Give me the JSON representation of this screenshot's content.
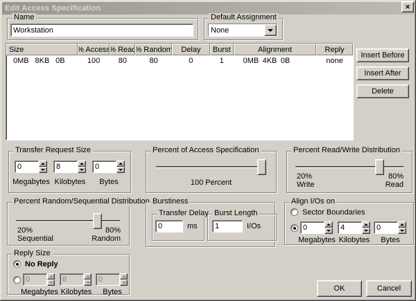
{
  "window": {
    "title": "Edit Access Specification",
    "close_glyph": "✕"
  },
  "name_group": {
    "label": "Name",
    "value": "Workstation"
  },
  "default_assignment_group": {
    "label": "Default Assignment",
    "value": "None"
  },
  "spec_table": {
    "columns": [
      "Size",
      "% Access",
      "% Read",
      "% Random",
      "Delay",
      "Burst",
      "Alignment",
      "Reply"
    ],
    "row": {
      "size": [
        "0MB",
        "8KB",
        "0B"
      ],
      "access": "100",
      "read": "80",
      "random": "80",
      "delay": "0",
      "burst": "1",
      "alignment": [
        "0MB",
        "4KB",
        "0B"
      ],
      "reply": "none"
    }
  },
  "actions": {
    "insert_before": "Insert Before",
    "insert_after": "Insert After",
    "delete": "Delete",
    "ok": "OK",
    "cancel": "Cancel"
  },
  "transfer_request_size": {
    "label": "Transfer Request Size",
    "fields": [
      {
        "value": "0",
        "unit": "Megabytes"
      },
      {
        "value": "8",
        "unit": "Kilobytes"
      },
      {
        "value": "0",
        "unit": "Bytes"
      }
    ]
  },
  "percent_access_spec": {
    "label": "Percent of Access Specification",
    "percent": 100,
    "value_label": "100 Percent"
  },
  "read_write_dist": {
    "label": "Percent Read/Write Distribution",
    "percent_read": 80,
    "left_pct": "20%",
    "left_label": "Write",
    "right_pct": "80%",
    "right_label": "Read"
  },
  "random_seq_dist": {
    "label": "Percent Random/Sequential Distribution",
    "percent_random": 80,
    "left_pct": "20%",
    "left_label": "Sequential",
    "right_pct": "80%",
    "right_label": "Random"
  },
  "burstiness": {
    "label": "Burstiness",
    "transfer_delay": {
      "label": "Transfer Delay",
      "value": "0",
      "unit": "ms"
    },
    "burst_length": {
      "label": "Burst Length",
      "value": "1",
      "unit": "I/Os"
    }
  },
  "align_ios": {
    "label": "Align I/Os on",
    "option_sector": "Sector Boundaries",
    "selected": "custom",
    "fields": [
      {
        "value": "0",
        "unit": "Megabytes"
      },
      {
        "value": "4",
        "unit": "Kilobytes"
      },
      {
        "value": "0",
        "unit": "Bytes"
      }
    ]
  },
  "reply_size": {
    "label": "Reply Size",
    "option_no_reply": "No Reply",
    "selected": "no_reply",
    "fields": [
      {
        "value": "0",
        "unit": "Megabytes"
      },
      {
        "value": "8",
        "unit": "Kilobytes"
      },
      {
        "value": "0",
        "unit": "Bytes"
      }
    ]
  },
  "colors": {
    "dialog_bg": "#d4d0c8",
    "titlebar_from": "#99978f",
    "titlebar_to": "#bcbab3",
    "title_text": "#dad7cf",
    "field_bg": "#ffffff",
    "disabled_text": "#848484"
  }
}
